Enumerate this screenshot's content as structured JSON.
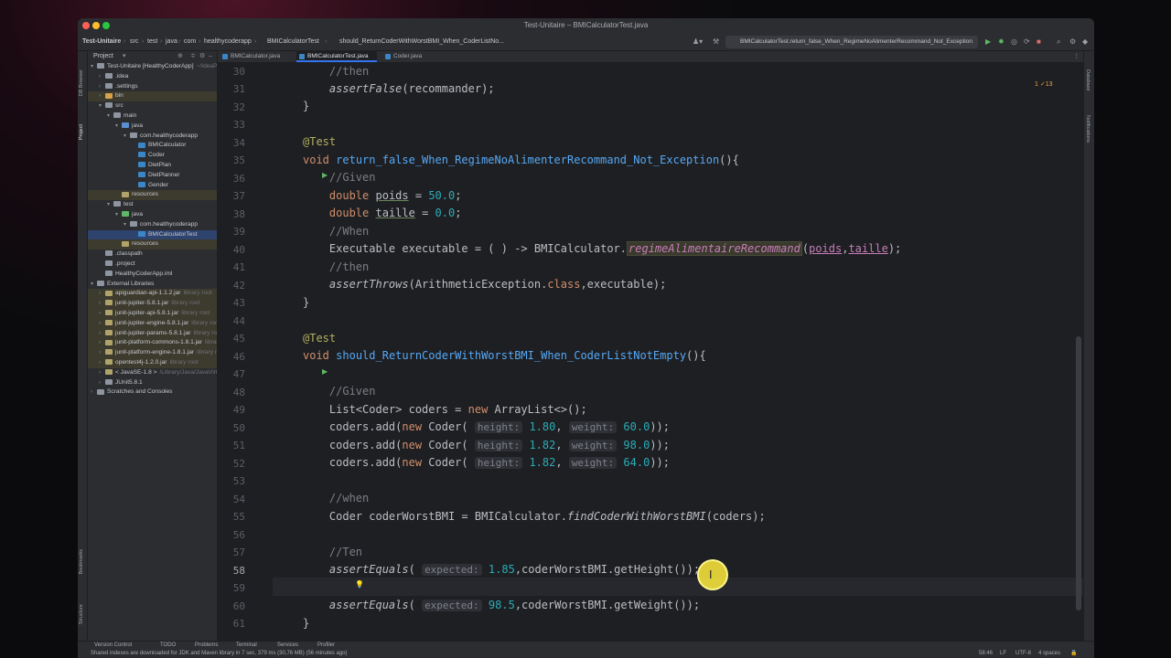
{
  "window": {
    "title": "Test-Unitaire – BMICalculatorTest.java"
  },
  "breadcrumbs": [
    "Test-Unitaire",
    "src",
    "test",
    "java",
    "com",
    "healthycoderapp",
    "BMICalculatorTest",
    "should_ReturnCoderWithWorstBMI_When_CoderListNo..."
  ],
  "run_config": "BMICalculatorTest.return_false_When_RegimeNoAlimenterRecommand_Not_Exception",
  "project_panel": {
    "title": "Project",
    "items": [
      {
        "label": "Test-Unitaire [HealthyCoderApp]",
        "extra": "~/IdeaProjects/..."
      },
      {
        "label": ".idea"
      },
      {
        "label": ".settings"
      },
      {
        "label": "bin"
      },
      {
        "label": "src"
      },
      {
        "label": "main"
      },
      {
        "label": "java"
      },
      {
        "label": "com.healthycoderapp"
      },
      {
        "label": "BMICalculator"
      },
      {
        "label": "Coder"
      },
      {
        "label": "DietPlan"
      },
      {
        "label": "DietPlanner"
      },
      {
        "label": "Gender"
      },
      {
        "label": "resources"
      },
      {
        "label": "test"
      },
      {
        "label": "java"
      },
      {
        "label": "com.healthycoderapp"
      },
      {
        "label": "BMICalculatorTest"
      },
      {
        "label": "resources"
      },
      {
        "label": ".classpath"
      },
      {
        "label": ".project"
      },
      {
        "label": "HealthyCoderApp.iml"
      },
      {
        "label": "External Libraries"
      },
      {
        "label": "apiguardian-api-1.1.2.jar",
        "extra": "library root"
      },
      {
        "label": "junit-jupiter-5.8.1.jar",
        "extra": "library root"
      },
      {
        "label": "junit-jupiter-api-5.8.1.jar",
        "extra": "library root"
      },
      {
        "label": "junit-jupiter-engine-5.8.1.jar",
        "extra": "library root"
      },
      {
        "label": "junit-jupiter-params-5.8.1.jar",
        "extra": "library root"
      },
      {
        "label": "junit-platform-commons-1.8.1.jar",
        "extra": "library root"
      },
      {
        "label": "junit-platform-engine-1.8.1.jar",
        "extra": "library root"
      },
      {
        "label": "opentest4j-1.2.0.jar",
        "extra": "library root"
      },
      {
        "label": "< JavaSE-1.8 >",
        "extra": "/Library/Java/JavaVirtualMachines/..."
      },
      {
        "label": "JUnit5.8.1"
      },
      {
        "label": "Scratches and Consoles"
      }
    ]
  },
  "tabs": [
    {
      "label": "BMICalculator.java"
    },
    {
      "label": "BMICalculatorTest.java"
    },
    {
      "label": "Coder.java"
    }
  ],
  "editor": {
    "line_numbers": [
      "30",
      "31",
      "32",
      "33",
      "34",
      "35",
      "36",
      "37",
      "38",
      "39",
      "40",
      "41",
      "42",
      "43",
      "44",
      "45",
      "46",
      "47",
      "48",
      "49",
      "50",
      "51",
      "52",
      "53",
      "54",
      "55",
      "56",
      "57",
      "58",
      "59",
      "60",
      "61"
    ],
    "inspections": "1 ✓13"
  },
  "status": {
    "items": [
      "Version Control",
      "TODO",
      "Problems",
      "Terminal",
      "Services",
      "Profiler"
    ],
    "message": "Shared indexes are downloaded for JDK and Maven library in 7 sec, 379 ms (30,76 MB) (56 minutes ago)",
    "position": "58:46",
    "line_sep": "LF",
    "encoding": "UTF-8",
    "indent": "4 spaces"
  },
  "side_labels": {
    "left": [
      "DB Browser",
      "Project",
      "Bookmarks",
      "Structure"
    ],
    "right": [
      "Database",
      "Notifications"
    ]
  }
}
